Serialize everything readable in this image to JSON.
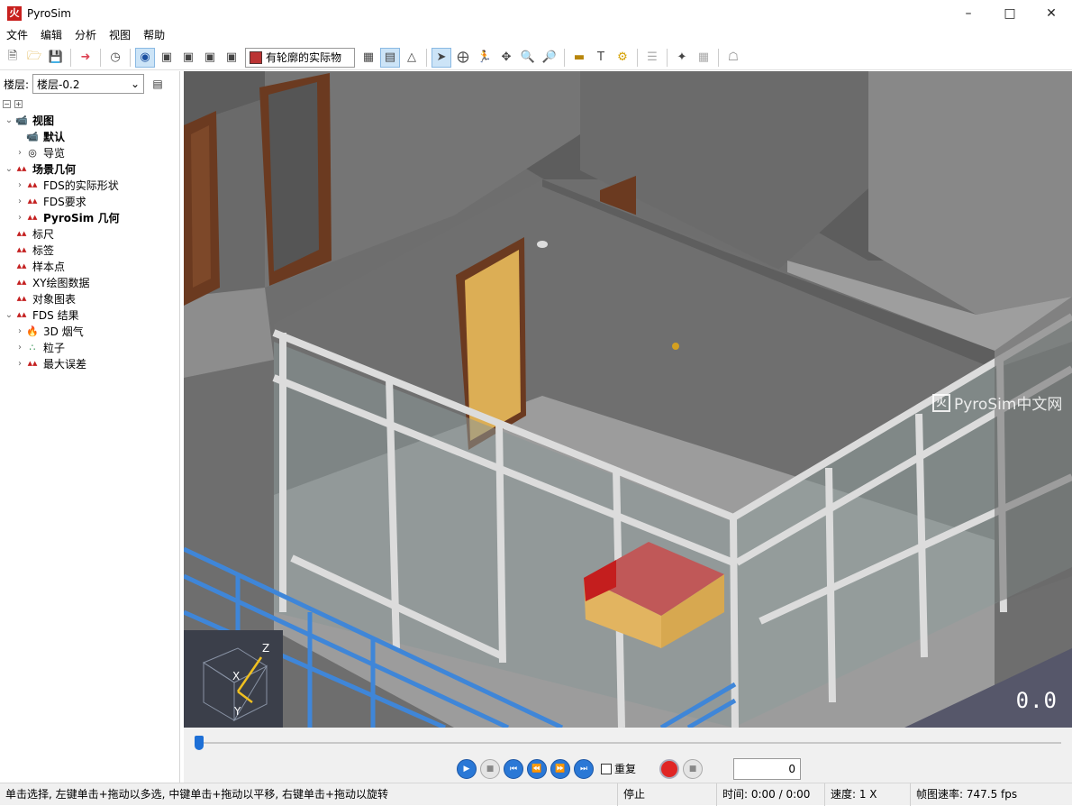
{
  "window": {
    "title": "PyroSim",
    "app_icon": "pyrosim-logo-icon"
  },
  "menu": [
    "文件",
    "编辑",
    "分析",
    "视图",
    "帮助"
  ],
  "toolbar": {
    "view_mode_select": "有轮廓的实际物"
  },
  "left": {
    "floor_label": "楼层:",
    "floor_value": "楼层-0.2",
    "tree": [
      {
        "label": "视图",
        "bold": true,
        "level": 0,
        "arrow": "expanded",
        "icon": "camera-icon"
      },
      {
        "label": "默认",
        "bold": true,
        "level": 1,
        "arrow": "none",
        "icon": "camera-icon"
      },
      {
        "label": "导览",
        "bold": false,
        "level": 1,
        "arrow": "collapsed",
        "icon": "tour-icon"
      },
      {
        "label": "场景几何",
        "bold": true,
        "level": 0,
        "arrow": "expanded",
        "icon": "geometry-icon"
      },
      {
        "label": "FDS的实际形状",
        "bold": false,
        "level": 1,
        "arrow": "collapsed",
        "icon": "geometry-icon"
      },
      {
        "label": "FDS要求",
        "bold": false,
        "level": 1,
        "arrow": "collapsed",
        "icon": "geometry-icon"
      },
      {
        "label": "PyroSim 几何",
        "bold": true,
        "level": 1,
        "arrow": "collapsed",
        "icon": "geometry-icon"
      },
      {
        "label": "标尺",
        "bold": false,
        "level": 0,
        "arrow": "none",
        "icon": "geometry-icon"
      },
      {
        "label": "标签",
        "bold": false,
        "level": 0,
        "arrow": "none",
        "icon": "geometry-icon"
      },
      {
        "label": "样本点",
        "bold": false,
        "level": 0,
        "arrow": "none",
        "icon": "geometry-icon"
      },
      {
        "label": "XY绘图数据",
        "bold": false,
        "level": 0,
        "arrow": "none",
        "icon": "geometry-icon"
      },
      {
        "label": "对象图表",
        "bold": false,
        "level": 0,
        "arrow": "none",
        "icon": "geometry-icon"
      },
      {
        "label": "FDS 结果",
        "bold": false,
        "level": 0,
        "arrow": "expanded",
        "icon": "geometry-icon"
      },
      {
        "label": "3D 烟气",
        "bold": false,
        "level": 1,
        "arrow": "collapsed",
        "icon": "smoke-icon"
      },
      {
        "label": "粒子",
        "bold": false,
        "level": 1,
        "arrow": "collapsed",
        "icon": "particles-icon"
      },
      {
        "label": "最大误差",
        "bold": false,
        "level": 1,
        "arrow": "collapsed",
        "icon": "geometry-icon"
      }
    ]
  },
  "viewport": {
    "watermark": "PyroSim中文网",
    "time_overlay": "0.0",
    "axis_labels": {
      "z": "Z",
      "x": "X",
      "y": "Y"
    }
  },
  "playback": {
    "repeat_label": "重复",
    "frame_value": "0"
  },
  "status": {
    "hint": "单击选择, 左键单击+拖动以多选, 中键单击+拖动以平移, 右键单击+拖动以旋转",
    "state": "停止",
    "time": "时间:   0:00 / 0:00",
    "speed": "速度:  1 X",
    "fps": "帧图速率:  747.5 fps"
  }
}
